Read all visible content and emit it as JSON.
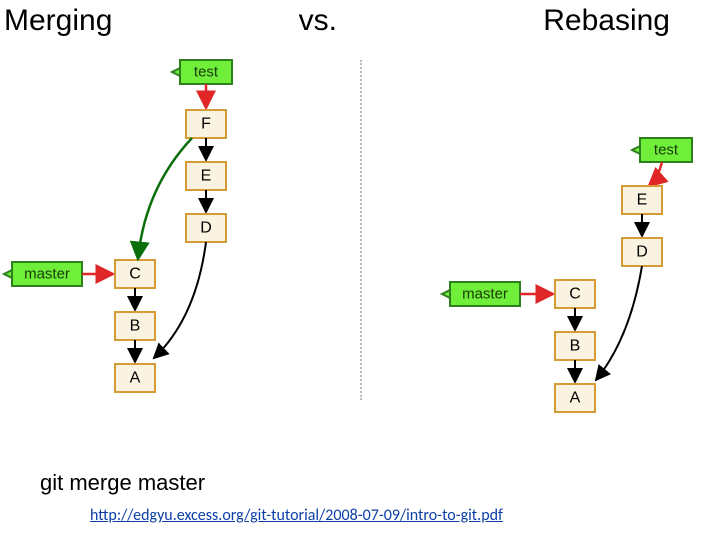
{
  "header": {
    "left": "Merging",
    "center": "vs.",
    "right": "Rebasing"
  },
  "branches": {
    "test": "test",
    "master": "master"
  },
  "merge_diagram": {
    "commits": {
      "F": "F",
      "E": "E",
      "D": "D",
      "C": "C",
      "B": "B",
      "A": "A"
    }
  },
  "rebase_diagram": {
    "commits": {
      "E": "E",
      "D": "D",
      "C": "C",
      "B": "B",
      "A": "A"
    }
  },
  "footer": {
    "command": "git merge master",
    "link": "http://edgyu.excess.org/git-tutorial/2008-07-09/intro-to-git.pdf"
  }
}
